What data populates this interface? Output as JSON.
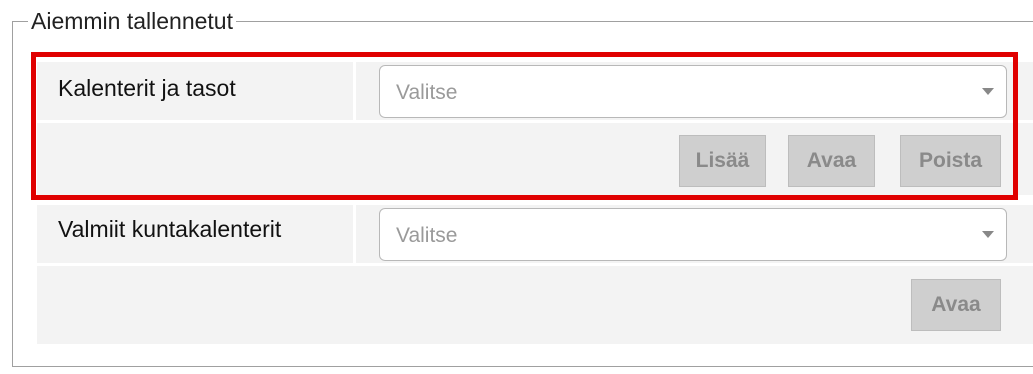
{
  "group": {
    "title": "Aiemmin tallennetut"
  },
  "rows": [
    {
      "label": "Kalenterit ja tasot",
      "select_value": "Valitse",
      "buttons": {
        "add": "Lisää",
        "open": "Avaa",
        "delete": "Poista"
      }
    },
    {
      "label": "Valmiit kuntakalenterit",
      "select_value": "Valitse",
      "buttons": {
        "open": "Avaa"
      }
    }
  ],
  "colors": {
    "highlight": "#e00000",
    "row_bg": "#f3f3f3",
    "button_bg": "#cfcfcf"
  }
}
